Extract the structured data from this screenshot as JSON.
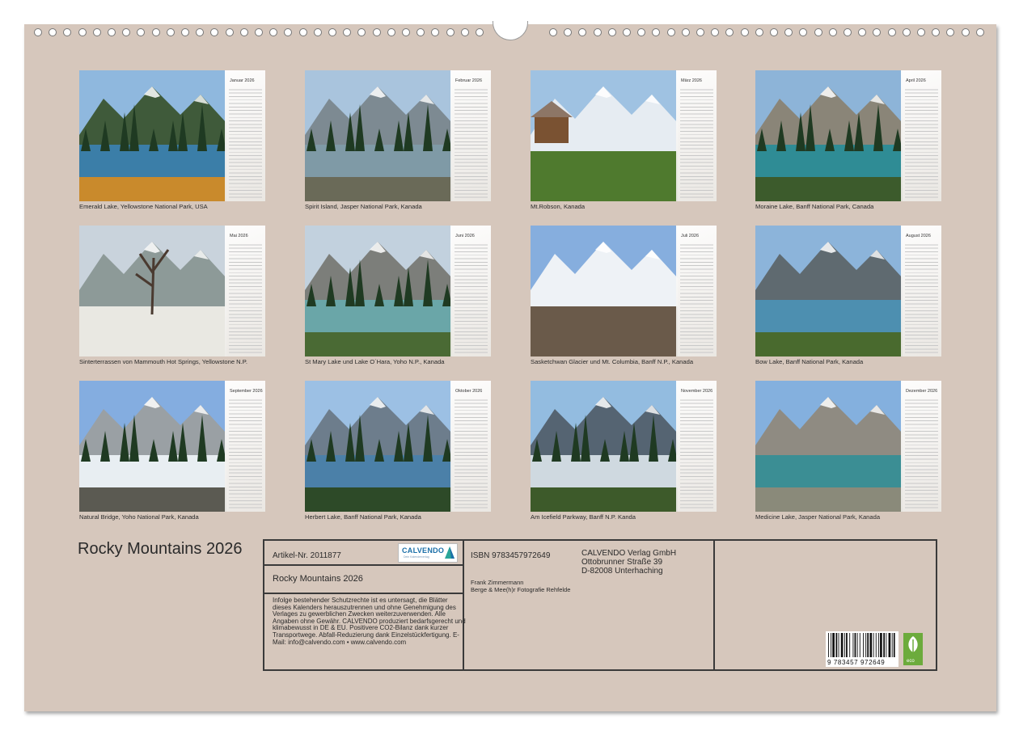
{
  "title": "Rocky Mountains 2026",
  "months": [
    {
      "name": "Januar 2026",
      "caption": "Emerald Lake, Yellowstone National Park, USA"
    },
    {
      "name": "Februar 2026",
      "caption": "Spirit Island, Jasper National Park, Kanada"
    },
    {
      "name": "März 2026",
      "caption": "Mt.Robson, Kanada"
    },
    {
      "name": "April 2026",
      "caption": "Moraine Lake, Banff National Park, Canada"
    },
    {
      "name": "Mai 2026",
      "caption": "Sinterterrassen von Mammouth Hot Springs, Yellowstone N.P."
    },
    {
      "name": "Juni 2026",
      "caption": "St Mary Lake und Lake O´Hara, Yoho N.P., Kanada"
    },
    {
      "name": "Juli 2026",
      "caption": "Sasketchwan Glacier und Mt. Columbia, Banff N.P., Kanada"
    },
    {
      "name": "August 2026",
      "caption": "Bow Lake, Banff National Park, Kanada"
    },
    {
      "name": "September 2026",
      "caption": "Natural Bridge, Yoho National Park, Kanada"
    },
    {
      "name": "Oktober 2026",
      "caption": "Herbert Lake, Banff National Park, Kanada"
    },
    {
      "name": "November 2026",
      "caption": "Am Icefield Parkway, Banff N.P. Kanda"
    },
    {
      "name": "Dezember 2026",
      "caption": "Medicine Lake, Jasper National Park, Kanada"
    }
  ],
  "info": {
    "article": "Artikel-Nr. 2011877",
    "logo_text": "CALVENDO",
    "logo_sub": "Dein Kalenderverlag",
    "book_title": "Rocky Mountains 2026",
    "legal": "Infolge bestehender Schutzrechte ist es untersagt, die Blätter dieses Kalenders herauszutrennen und ohne Genehmigung des Verlages zu gewerblichen Zwecken weiterzuverwenden. Alle Angaben ohne Gewähr. CALVENDO produziert bedarfsgerecht und klimabewusst in DE & EU. Positivere CO2-Bilanz dank kurzer Transportwege. Abfall-Reduzierung dank Einzelstückfertigung. E-Mail: info@calvendo.com • www.calvendo.com",
    "isbn": "ISBN 9783457972649",
    "publisher_name": "CALVENDO Verlag GmbH",
    "publisher_street": "Ottobrunner Straße 39",
    "publisher_city": "D-82008 Unterhaching",
    "author": "Frank Zimmermann",
    "author_org": "Berge & Mee(h)r Fotografie Rehfelde",
    "barcode_digits": "9 783457 972649",
    "eco_label": "eco"
  }
}
